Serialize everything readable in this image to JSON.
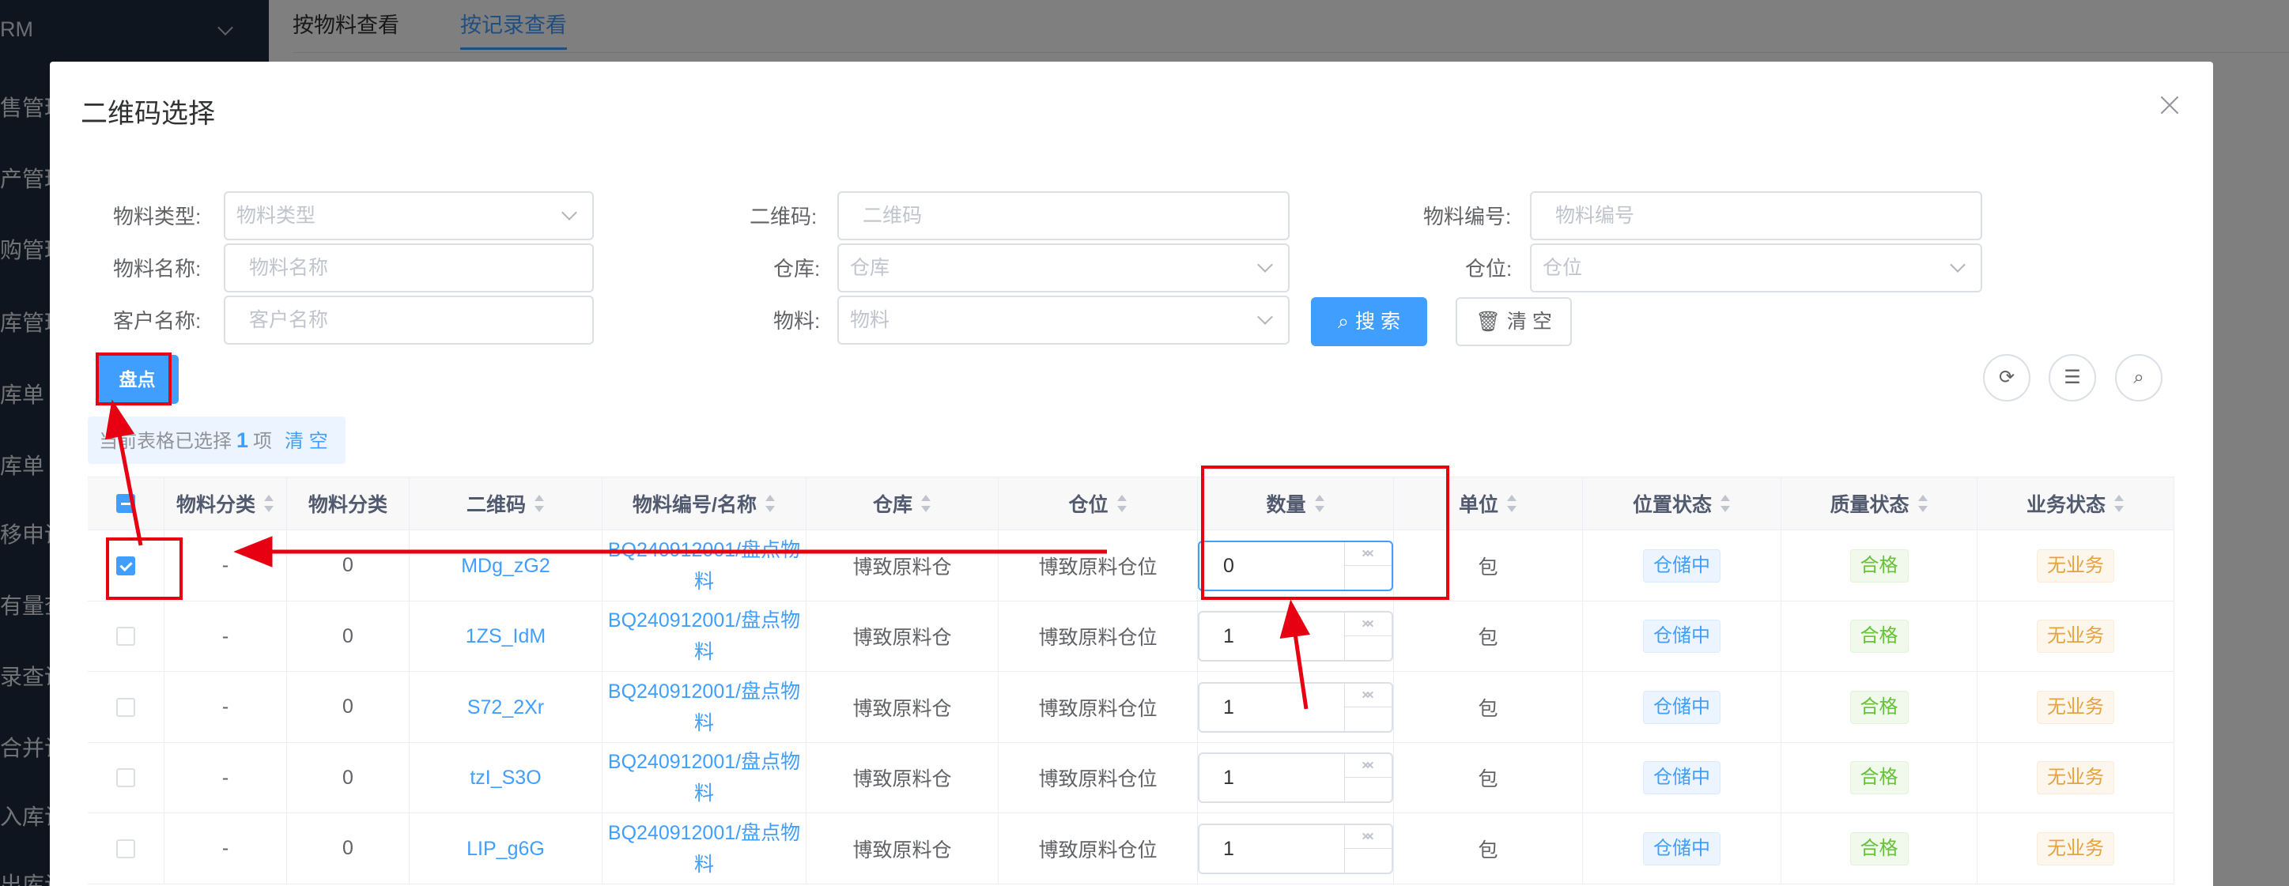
{
  "background": {
    "sidebar_logo": "RM",
    "sidebar_items": [
      "售管理",
      "产管理",
      "购管理",
      "库管理",
      "库单",
      "库单",
      "移申请",
      "有量查",
      "录查询",
      "合并记",
      "入库记",
      "出库记"
    ],
    "tabs": [
      {
        "label": "按物料查看"
      },
      {
        "label": "按记录查看"
      }
    ]
  },
  "dialog": {
    "title": "二维码选择",
    "filters": {
      "material_type": {
        "label": "物料类型:",
        "placeholder": "物料类型"
      },
      "qrcode": {
        "label": "二维码:",
        "placeholder": "二维码"
      },
      "material_code": {
        "label": "物料编号:",
        "placeholder": "物料编号"
      },
      "material_name": {
        "label": "物料名称:",
        "placeholder": "物料名称"
      },
      "warehouse": {
        "label": "仓库:",
        "placeholder": "仓库"
      },
      "location": {
        "label": "仓位:",
        "placeholder": "仓位"
      },
      "customer_name": {
        "label": "客户名称:",
        "placeholder": "客户名称"
      },
      "material": {
        "label": "物料:",
        "placeholder": "物料"
      }
    },
    "search_label": "搜 索",
    "clear_label": "清 空",
    "pandian_label": "盘点",
    "selection": {
      "prefix": "当前表格已选择",
      "count": "1",
      "unit": "项",
      "clear": "清 空"
    },
    "table": {
      "headers": [
        "物料分类",
        "物料分类",
        "二维码",
        "物料编号/名称",
        "仓库",
        "仓位",
        "数量",
        "单位",
        "位置状态",
        "质量状态",
        "业务状态"
      ],
      "rows": [
        {
          "checked": true,
          "cat1": "-",
          "cat2": "0",
          "qrcode": "MDg_zG2",
          "material_line1": "BQ240912001/盘点物",
          "material_line2": "料",
          "warehouse": "博致原料仓",
          "location": "博致原料仓位",
          "qty": "0",
          "unit": "包",
          "loc_status": "仓储中",
          "quality": "合格",
          "business": "无业务"
        },
        {
          "checked": false,
          "cat1": "-",
          "cat2": "0",
          "qrcode": "1ZS_IdM",
          "material_line1": "BQ240912001/盘点物",
          "material_line2": "料",
          "warehouse": "博致原料仓",
          "location": "博致原料仓位",
          "qty": "1",
          "unit": "包",
          "loc_status": "仓储中",
          "quality": "合格",
          "business": "无业务"
        },
        {
          "checked": false,
          "cat1": "-",
          "cat2": "0",
          "qrcode": "S72_2Xr",
          "material_line1": "BQ240912001/盘点物",
          "material_line2": "料",
          "warehouse": "博致原料仓",
          "location": "博致原料仓位",
          "qty": "1",
          "unit": "包",
          "loc_status": "仓储中",
          "quality": "合格",
          "business": "无业务"
        },
        {
          "checked": false,
          "cat1": "-",
          "cat2": "0",
          "qrcode": "tzI_S3O",
          "material_line1": "BQ240912001/盘点物",
          "material_line2": "料",
          "warehouse": "博致原料仓",
          "location": "博致原料仓位",
          "qty": "1",
          "unit": "包",
          "loc_status": "仓储中",
          "quality": "合格",
          "business": "无业务"
        },
        {
          "checked": false,
          "cat1": "-",
          "cat2": "0",
          "qrcode": "LIP_g6G",
          "material_line1": "BQ240912001/盘点物",
          "material_line2": "料",
          "warehouse": "博致原料仓",
          "location": "博致原料仓位",
          "qty": "1",
          "unit": "包",
          "loc_status": "仓储中",
          "quality": "合格",
          "business": "无业务"
        }
      ]
    }
  },
  "colors": {
    "primary": "#409eff",
    "annotation_red": "#e60012",
    "success": "#67c23a",
    "warning": "#e6a23c"
  }
}
